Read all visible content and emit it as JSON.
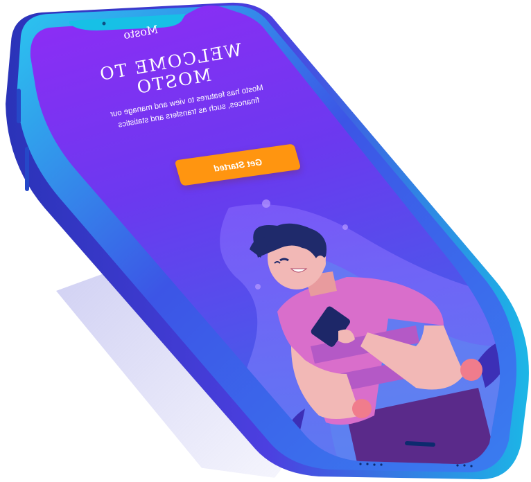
{
  "app": {
    "brand": "Mosto"
  },
  "hero": {
    "title": "WELCOME TO MOSTO",
    "description": "Mosto has features to view and manage our finances, such as transfers and statistics",
    "cta_label": "Get Started"
  },
  "colors": {
    "frame_outer": "#2f35d0",
    "frame_edge": "#19c5e8",
    "screen_top": "#7b2ff7",
    "screen_bottom": "#4a5ee8",
    "button": "#ff9510",
    "shirt": "#d86ac8",
    "hair": "#1f2a6b",
    "skin": "#f2b8b6"
  }
}
